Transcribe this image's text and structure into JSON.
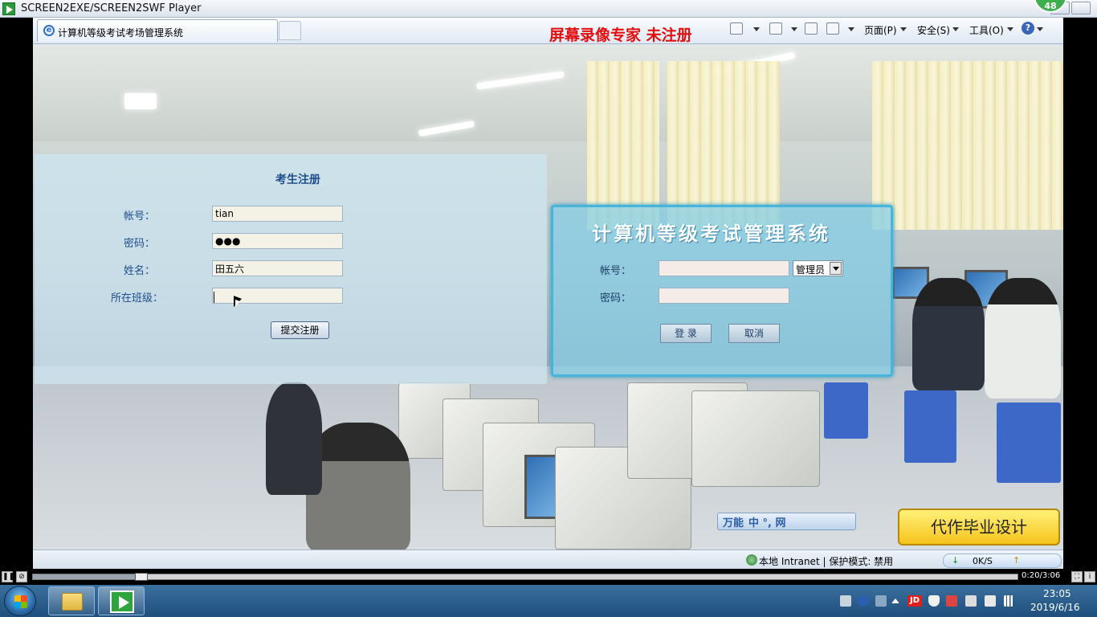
{
  "window": {
    "title": "SCREEN2EXE/SCREEN2SWF Player",
    "badge": "48"
  },
  "browser": {
    "tab_title": "计算机等级考试考场管理系统",
    "recorder_watermark": "屏幕录像专家 未注册",
    "menus": [
      "页面(P)",
      "安全(S)",
      "工具(O)"
    ]
  },
  "register": {
    "title": "考生注册",
    "account_label": "帐号：",
    "account_value": "tian",
    "password_label": "密码：",
    "password_value": "●●●",
    "name_label": "姓名：",
    "name_value": "田五六",
    "class_label": "所在班级：",
    "class_value": "",
    "submit_label": "提交注册"
  },
  "login": {
    "title": "计算机等级考试管理系统",
    "account_label": "帐号：",
    "password_label": "密码：",
    "role_selected": "管理员",
    "login_button": "登 录",
    "cancel_button": "取消"
  },
  "ime_bar": {
    "label": "万能",
    "chars": "中 °, 网"
  },
  "promo": "代作毕业设计",
  "statusbar": {
    "zone": "本地 Intranet | 保护模式: 禁用",
    "net_speed": "0K/S"
  },
  "player": {
    "time": "0:20/3:06",
    "progress": 0.11
  },
  "taskbar": {
    "time": "23:05",
    "date": "2019/6/16",
    "tray_jd": "JD"
  },
  "colors": {
    "accent_blue": "#1e4d8c",
    "login_border": "#48b4d9",
    "recorder_red": "#e01010",
    "promo_yellow": "#f6c21b"
  }
}
